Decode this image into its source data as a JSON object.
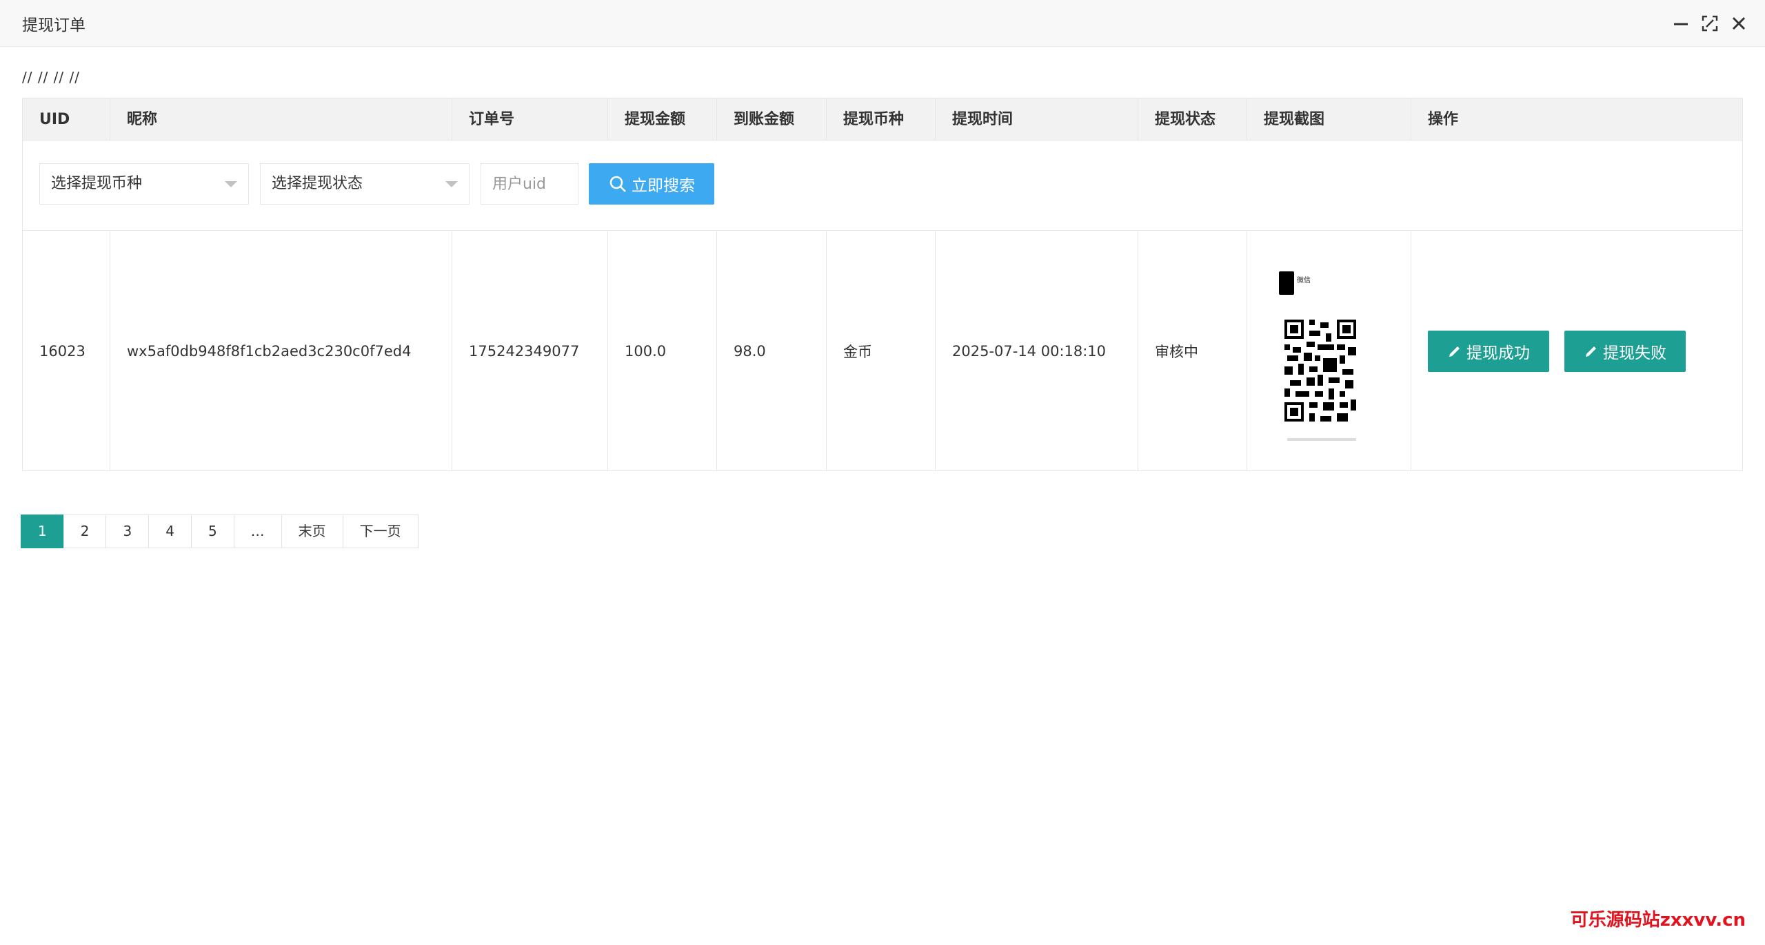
{
  "window": {
    "title": "提现订单"
  },
  "breadcrumb": "// // // //",
  "table": {
    "columns": [
      "UID",
      "昵称",
      "订单号",
      "提现金额",
      "到账金额",
      "提现币种",
      "提现时间",
      "提现状态",
      "提现截图",
      "操作"
    ],
    "filters": {
      "currency_select": "选择提现币种",
      "status_select": "选择提现状态",
      "uid_placeholder": "用户uid",
      "search_label": "立即搜索"
    },
    "rows": [
      {
        "uid": "16023",
        "nickname": "wx5af0db948f8f1cb2aed3c230c0f7ed4",
        "order_no": "175242349077",
        "amount": "100.0",
        "received": "98.0",
        "currency": "金币",
        "time": "2025-07-14 00:18:10",
        "status": "审核中",
        "screenshot_label": "微信",
        "actions": {
          "success": "提现成功",
          "fail": "提现失败"
        }
      }
    ]
  },
  "pagination": [
    "1",
    "2",
    "3",
    "4",
    "5",
    "…",
    "末页",
    "下一页"
  ],
  "watermark": "可乐源码站zxxvv.cn",
  "colors": {
    "primary": "#1e9f93",
    "search": "#3ca9f0",
    "watermark": "#e0141e"
  }
}
